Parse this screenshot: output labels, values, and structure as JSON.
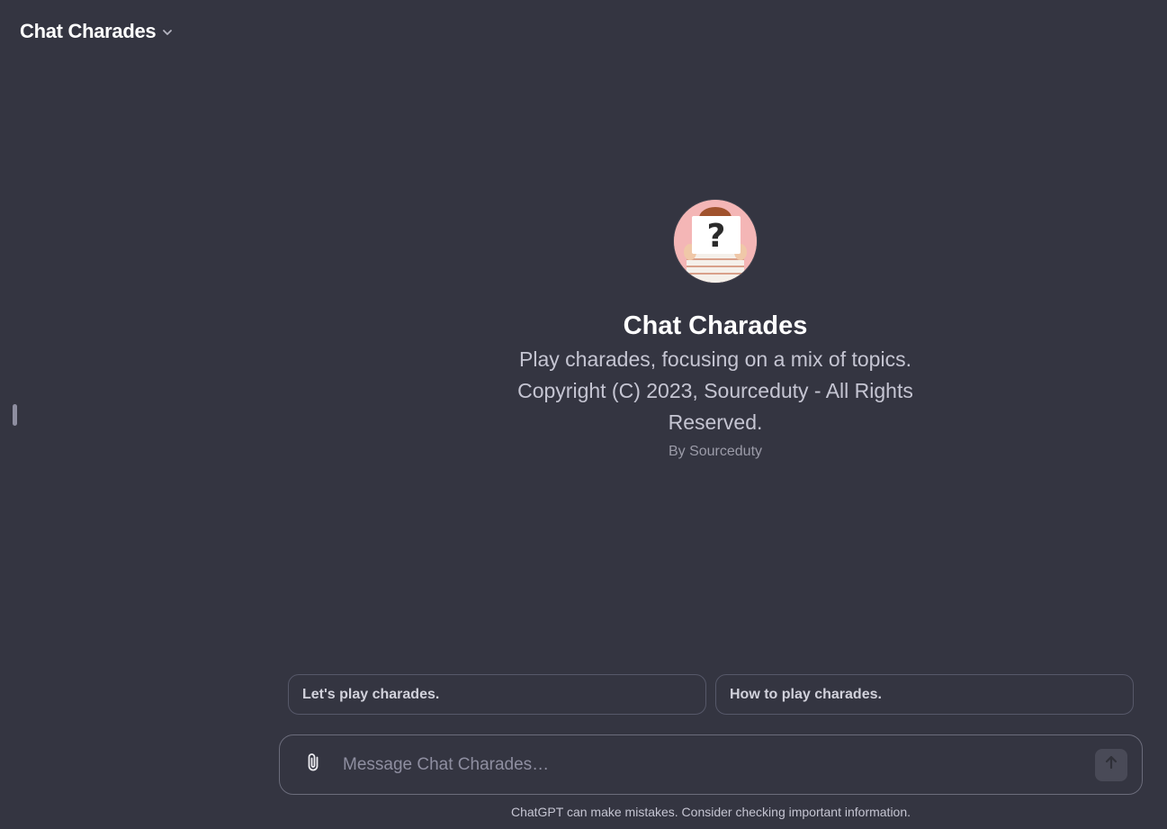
{
  "header": {
    "title": "Chat Charades",
    "dropdown_icon": "chevron-down-icon"
  },
  "gpt": {
    "name": "Chat Charades",
    "description": "Play charades, focusing on a mix of topics. Copyright (C) 2023, Sourceduty - All Rights Reserved.",
    "author": "By Sourceduty",
    "avatar_bg": "#f4b6b6"
  },
  "suggestions": [
    {
      "label": "Let's play charades."
    },
    {
      "label": "How to play charades."
    }
  ],
  "composer": {
    "placeholder": "Message Chat Charades…",
    "value": "",
    "attach_icon": "paperclip-icon",
    "send_icon": "arrow-up-icon"
  },
  "footer": {
    "disclaimer": "ChatGPT can make mistakes. Consider checking important information."
  },
  "colors": {
    "background": "#343541",
    "border": "#565869",
    "send_button": "#494a57"
  }
}
